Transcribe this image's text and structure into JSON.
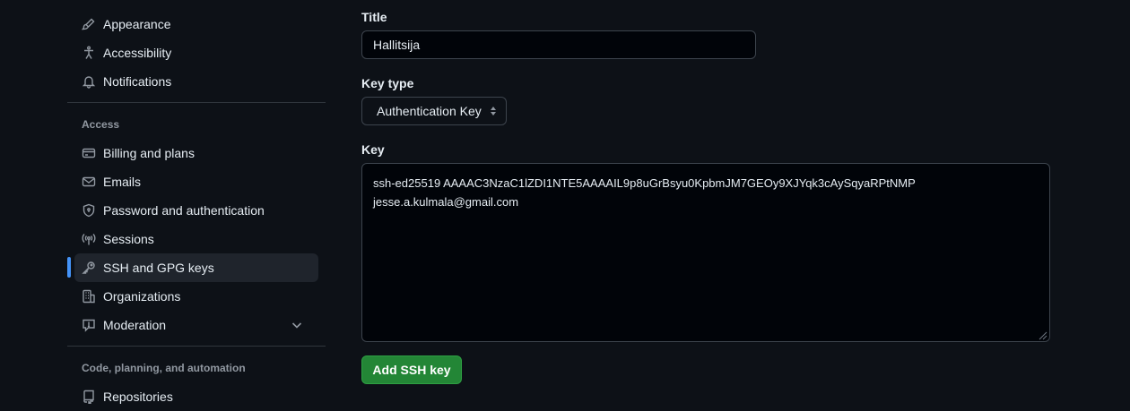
{
  "sidebar": {
    "items": [
      {
        "label": "Appearance",
        "icon": "paintbrush-icon"
      },
      {
        "label": "Accessibility",
        "icon": "accessibility-icon"
      },
      {
        "label": "Notifications",
        "icon": "bell-icon"
      },
      {
        "label": "Billing and plans",
        "icon": "credit-card-icon"
      },
      {
        "label": "Emails",
        "icon": "mail-icon"
      },
      {
        "label": "Password and authentication",
        "icon": "shield-lock-icon"
      },
      {
        "label": "Sessions",
        "icon": "broadcast-icon"
      },
      {
        "label": "SSH and GPG keys",
        "icon": "key-icon",
        "active": true
      },
      {
        "label": "Organizations",
        "icon": "organization-icon"
      },
      {
        "label": "Moderation",
        "icon": "report-icon"
      },
      {
        "label": "Repositories",
        "icon": "repo-icon"
      }
    ],
    "sections": {
      "access": "Access",
      "code": "Code, planning, and automation"
    }
  },
  "form": {
    "title_label": "Title",
    "title_value": "Hallitsija",
    "key_type_label": "Key type",
    "key_type_value": "Authentication Key",
    "key_label": "Key",
    "key_line_1": "ssh-ed25519 AAAAC3NzaC1lZDI1NTE5AAAAIL9p8uGrBsyu0KpbmJM7GEOy9XJYqk3cAySqyaRPtNMP",
    "key_line_2": "jesse.a.kulmala@gmail.com",
    "submit_label": "Add SSH key"
  },
  "colors": {
    "background": "#0d1117",
    "accent": "#4493f8",
    "primary_button": "#238636"
  }
}
